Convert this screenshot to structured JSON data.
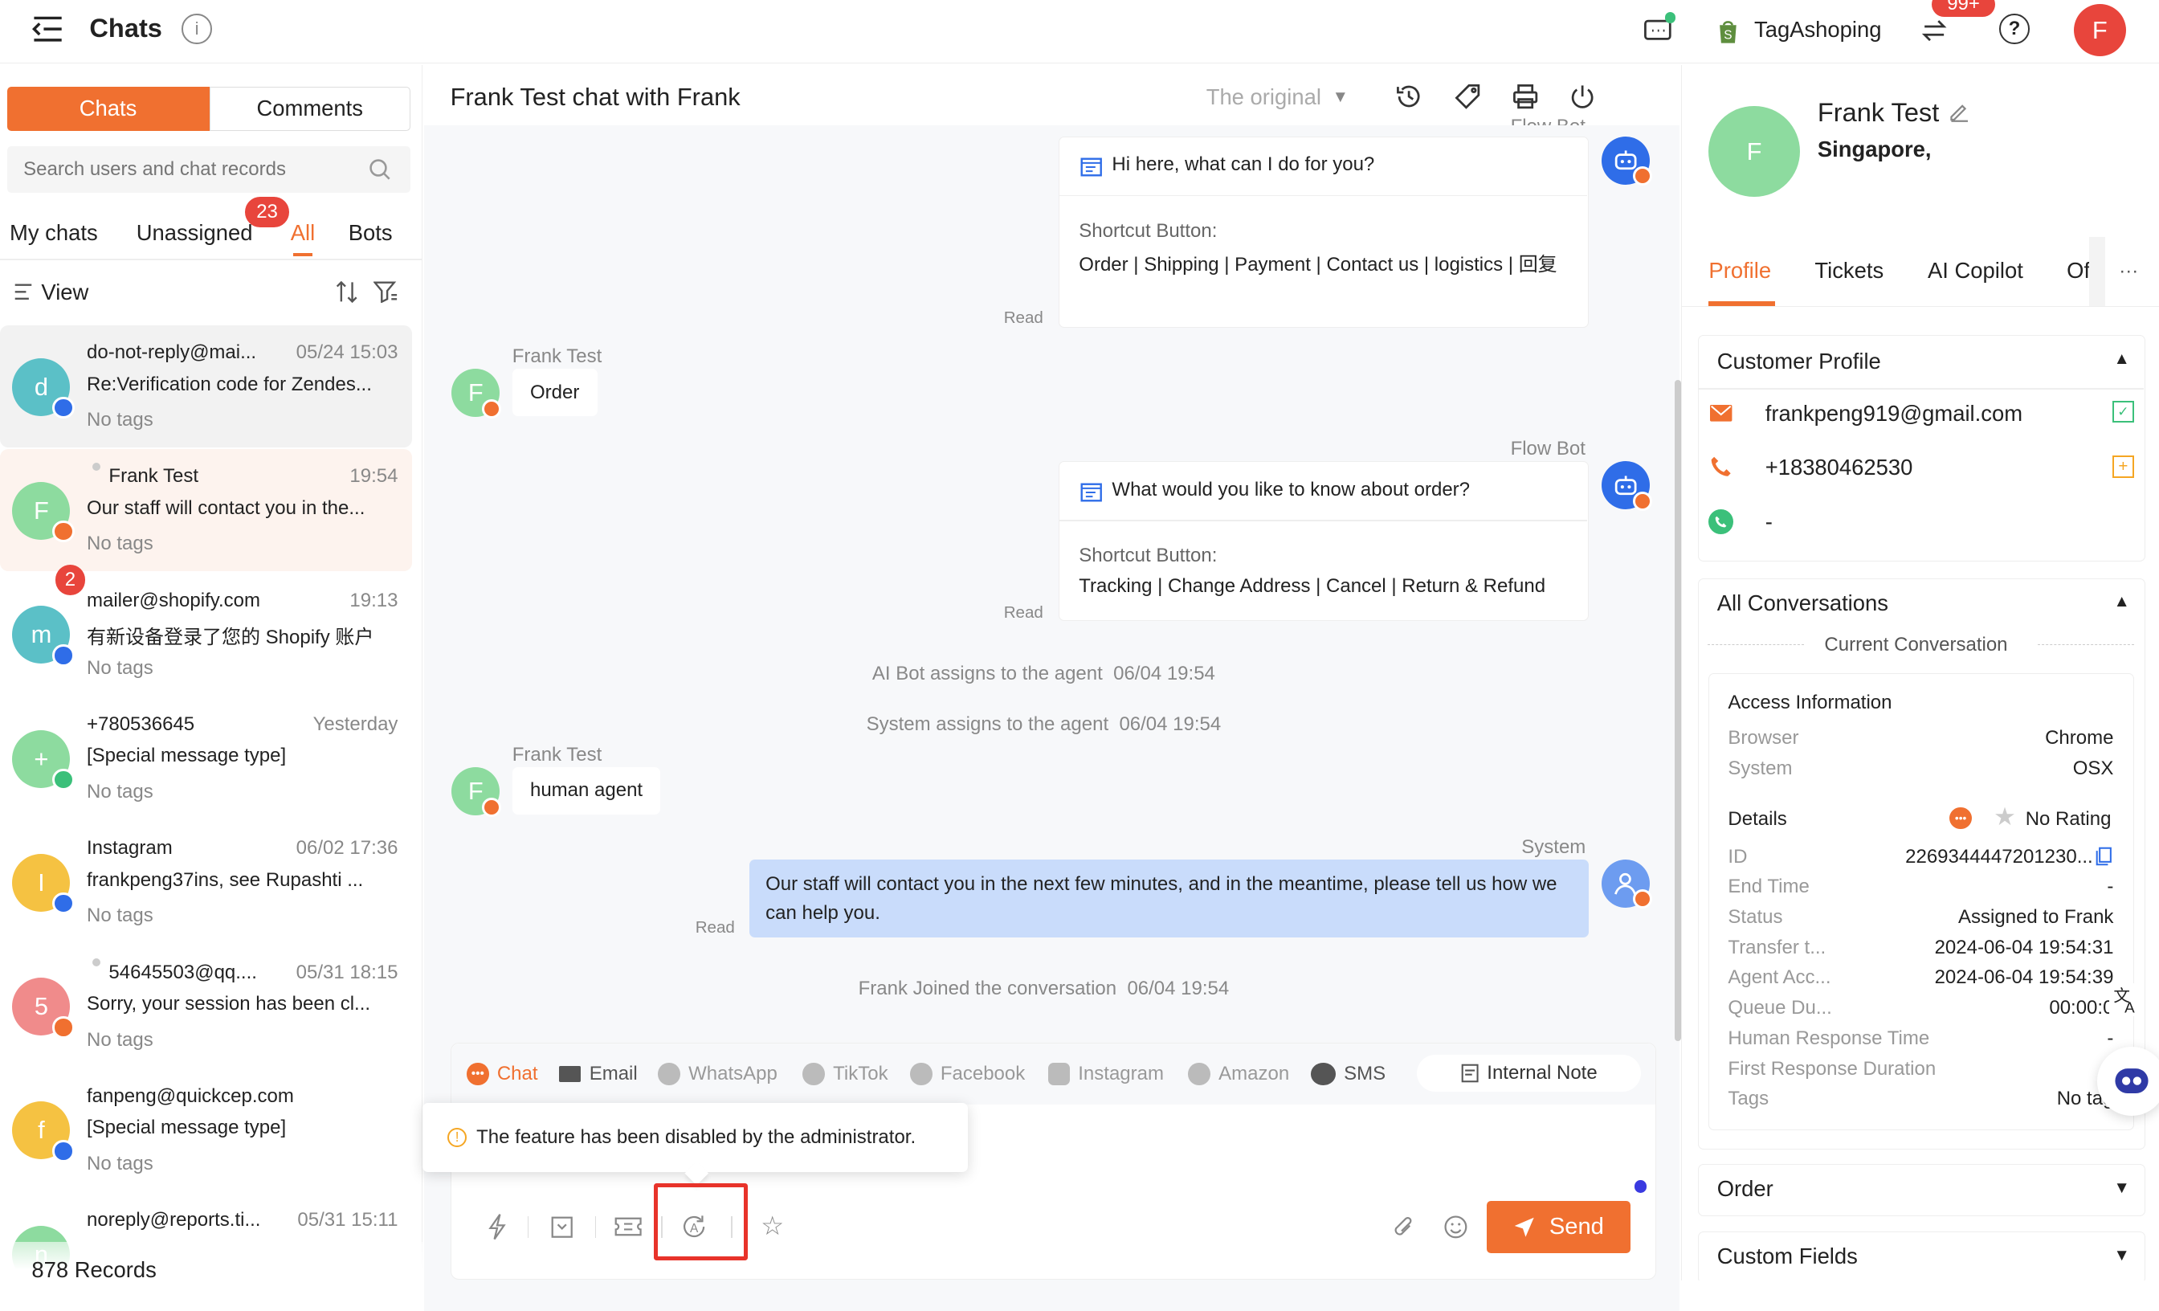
{
  "topbar": {
    "title": "Chats",
    "store": "TagAshoping",
    "notif_badge": "99+",
    "user_initial": "F"
  },
  "left": {
    "tabs": [
      "Chats",
      "Comments"
    ],
    "search_placeholder": "Search users and chat records",
    "filters": [
      "My chats",
      "Unassigned",
      "All",
      "Bots"
    ],
    "unassigned_badge": "23",
    "view_label": "View",
    "records": "878 Records",
    "chats": [
      {
        "initial": "d",
        "color": "#5bc0c7",
        "name": "do-not-reply@mai...",
        "time": "05/24 15:03",
        "msg": "Re:Verification code for Zendes...",
        "tags": "No tags",
        "sub": "mail",
        "badge": ""
      },
      {
        "initial": "F",
        "color": "#8ddb9f",
        "name": "Frank Test",
        "time": "19:54",
        "msg": "Our staff will contact you in the...",
        "tags": "No tags",
        "sub": "chat",
        "badge": ""
      },
      {
        "initial": "m",
        "color": "#5bc0c7",
        "name": "mailer@shopify.com",
        "time": "19:13",
        "msg": "有新设备登录了您的 Shopify 账户",
        "tags": "No tags",
        "sub": "mail",
        "badge": "2"
      },
      {
        "initial": "+",
        "color": "#8ddb9f",
        "name": "+780536645",
        "time": "Yesterday",
        "msg": "[Special message type]",
        "tags": "No tags",
        "sub": "wa",
        "badge": ""
      },
      {
        "initial": "I",
        "color": "#f5c242",
        "name": "Instagram",
        "time": "06/02 17:36",
        "msg": "frankpeng37ins, see Rupashti ...",
        "tags": "No tags",
        "sub": "mail",
        "badge": ""
      },
      {
        "initial": "5",
        "color": "#f08b8b",
        "name": "54645503@qq....",
        "time": "05/31 18:15",
        "msg": "Sorry, your session has been cl...",
        "tags": "No tags",
        "sub": "chat",
        "badge": ""
      },
      {
        "initial": "f",
        "color": "#f5c242",
        "name": "fanpeng@quickcep.com",
        "time": "",
        "msg": "[Special message type]",
        "tags": "No tags",
        "sub": "mail",
        "badge": ""
      },
      {
        "initial": "n",
        "color": "#8ddb9f",
        "name": "noreply@reports.ti...",
        "time": "05/31 15:11",
        "msg": "",
        "tags": "",
        "sub": "",
        "badge": ""
      }
    ]
  },
  "center": {
    "title": "Frank Test chat with Frank",
    "translate_mode": "The original",
    "flow_bot_cut": "Flow Bot",
    "bot1": {
      "heading": "Hi here, what can I do for you?",
      "shortcut_label": "Shortcut Button:",
      "buttons": "Order | Shipping | Payment | Contact us | logistics | 回复",
      "read": "Read"
    },
    "user1": {
      "name": "Frank Test",
      "text": "Order"
    },
    "bot2": {
      "sender": "Flow Bot",
      "heading": "What would you like to know about order?",
      "shortcut_label": "Shortcut Button:",
      "buttons": "Tracking | Change Address | Cancel | Return & Refund",
      "read": "Read"
    },
    "sys1": "AI Bot assigns to the agent  06/04 19:54",
    "sys2": "System assigns to the agent  06/04 19:54",
    "user2": {
      "name": "Frank Test",
      "text": "human agent"
    },
    "sys_msg": {
      "sender": "System",
      "text": "Our staff will contact you in the next few minutes, and in the meantime, please tell us how we can help you.",
      "read": "Read"
    },
    "sys3": "Frank Joined the conversation  06/04 19:54",
    "channels": [
      "Chat",
      "Email",
      "WhatsApp",
      "TikTok",
      "Facebook",
      "Instagram",
      "Amazon",
      "SMS"
    ],
    "internal_note": "Internal Note",
    "tooltip": "The feature has been disabled by the administrator.",
    "send": "Send"
  },
  "right": {
    "name": "Frank Test",
    "location": "Singapore,",
    "initial": "F",
    "tabs": [
      "Profile",
      "Tickets",
      "AI Copilot",
      "Of"
    ],
    "customer_profile": "Customer Profile",
    "email": "frankpeng919@gmail.com",
    "phone": "+18380462530",
    "whatsapp": "-",
    "all_conversations": "All Conversations",
    "current_conversation": "Current Conversation",
    "access_info": "Access Information",
    "browser": {
      "k": "Browser",
      "v": "Chrome"
    },
    "system": {
      "k": "System",
      "v": "OSX"
    },
    "details": "Details",
    "rating": "No Rating",
    "rows": [
      {
        "k": "ID",
        "v": "2269344447201230..."
      },
      {
        "k": "End Time",
        "v": "-"
      },
      {
        "k": "Status",
        "v": "Assigned to Frank"
      },
      {
        "k": "Transfer t...",
        "v": "2024-06-04 19:54:31"
      },
      {
        "k": "Agent Acc...",
        "v": "2024-06-04 19:54:39"
      },
      {
        "k": "Queue Du...",
        "v": "00:00:0"
      },
      {
        "k": "Human Response Time",
        "v": "-"
      },
      {
        "k": "First Response Duration",
        "v": ""
      },
      {
        "k": "Tags",
        "v": "No tag"
      }
    ],
    "order": "Order",
    "custom_fields": "Custom Fields"
  },
  "colors": {
    "accent": "#f07030",
    "blue": "#2f6de8",
    "sys_bubble": "#c9dcfb"
  }
}
